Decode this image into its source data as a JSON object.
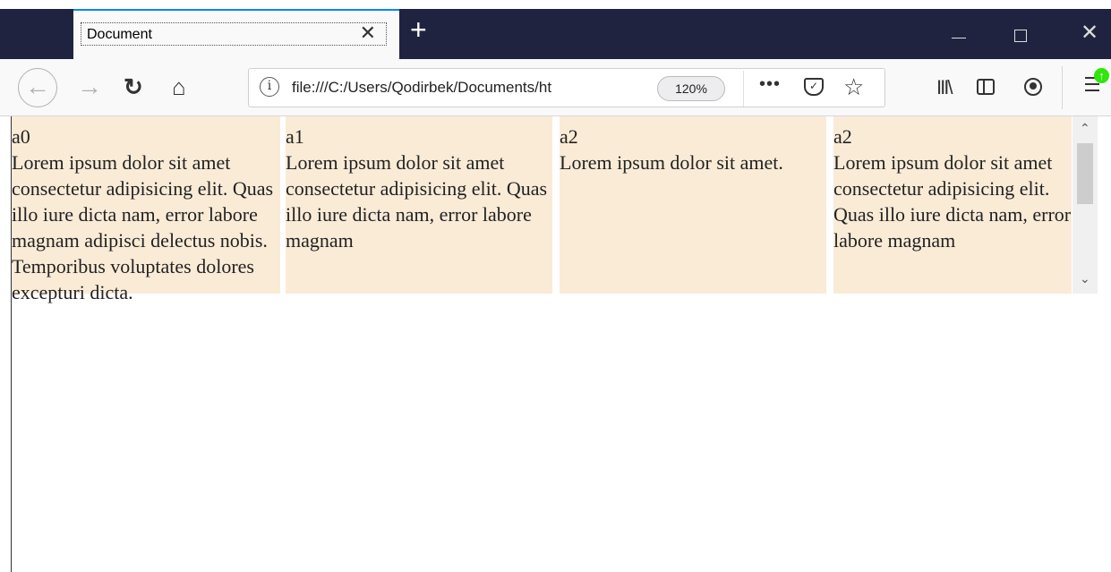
{
  "browser": {
    "tab_title": "Document",
    "tab_close_glyph": "✕",
    "new_tab_glyph": "+",
    "url": "file:///C:/Users/Qodirbek/Documents/ht",
    "zoom": "120%",
    "more_glyph": "•••",
    "icons": [
      "back-icon",
      "forward-icon",
      "reload-icon",
      "home-icon",
      "info-icon",
      "pocket-icon",
      "bookmark-star-icon",
      "library-icon",
      "sidebar-icon",
      "account-icon",
      "menu-icon",
      "update-icon"
    ]
  },
  "columns": [
    {
      "heading": "a0",
      "text": "Lorem ipsum dolor sit amet consectetur adipisicing elit. Quas illo iure dicta nam, error labore magnam adipisci delectus nobis. Temporibus voluptates dolores excepturi dicta."
    },
    {
      "heading": "a1",
      "text": "Lorem ipsum dolor sit amet consectetur adipisicing elit. Quas illo iure dicta nam, error labore magnam"
    },
    {
      "heading": "a2",
      "text": "Lorem ipsum dolor sit amet."
    },
    {
      "heading": "a2",
      "text": "Lorem ipsum dolor sit amet consectetur adipisicing elit. Quas illo iure dicta nam, error labore magnam"
    }
  ],
  "colors": {
    "column_bg": "#faebd7",
    "titlebar_bg": "#202340",
    "tab_accent": "#0a84ff"
  }
}
